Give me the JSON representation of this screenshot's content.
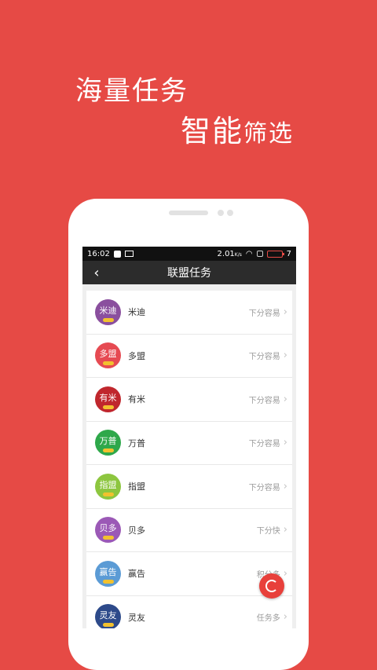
{
  "promo": {
    "headline_1": "海量任务",
    "headline_2_main": "智能",
    "headline_2_small": "筛选"
  },
  "status_bar": {
    "time": "16:02",
    "speed": "2.01",
    "speed_unit": "K/s",
    "battery": "7"
  },
  "nav": {
    "back_icon": "‹",
    "title": "联盟任务"
  },
  "colors": {
    "background": "#e64a45",
    "nav": "#2c2c2c",
    "status": "#111111"
  },
  "tasks": [
    {
      "logo": "米迪",
      "name": "米迪",
      "tag": "下分容易",
      "color": "#8a4f9e"
    },
    {
      "logo": "多盟",
      "name": "多盟",
      "tag": "下分容易",
      "color": "#e64a52"
    },
    {
      "logo": "有米",
      "name": "有米",
      "tag": "下分容易",
      "color": "#c0272d"
    },
    {
      "logo": "万普",
      "name": "万普",
      "tag": "下分容易",
      "color": "#2ea84a"
    },
    {
      "logo": "指盟",
      "name": "指盟",
      "tag": "下分容易",
      "color": "#8dc63f"
    },
    {
      "logo": "贝多",
      "name": "贝多",
      "tag": "下分快",
      "color": "#9b59b6"
    },
    {
      "logo": "赢告",
      "name": "赢告",
      "tag": "积分多",
      "color": "#5b9bd5"
    },
    {
      "logo": "灵友",
      "name": "灵友",
      "tag": "任务多",
      "color": "#2d4a8a"
    }
  ],
  "chevron": "›"
}
